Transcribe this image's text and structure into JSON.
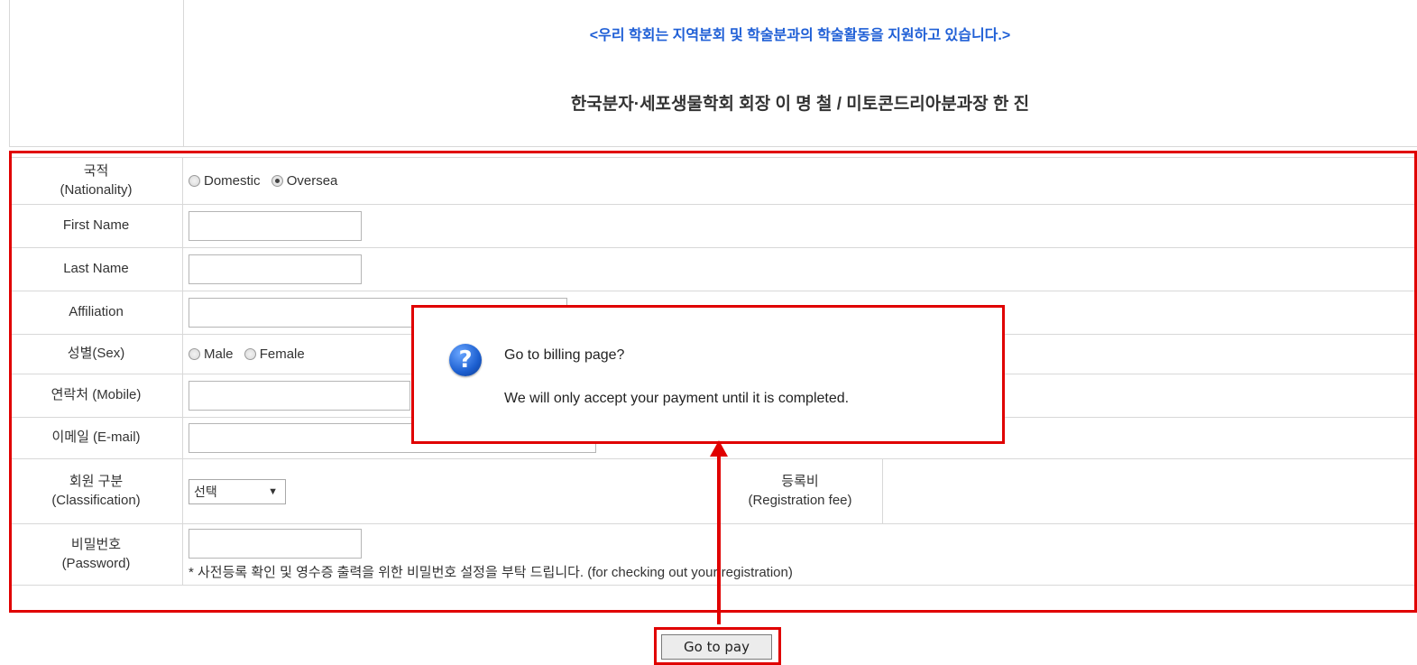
{
  "header": {
    "notice": "<우리 학회는 지역분회 및 학술분과의 학술활동을 지원하고 있습니다.>",
    "title": "한국분자·세포생물학회 회장 이 명 철 / 미토콘드리아분과장 한 진"
  },
  "form": {
    "nationality": {
      "label_ko": "국적",
      "label_en": "(Nationality)",
      "options": [
        "Domestic",
        "Oversea"
      ],
      "selected": "Oversea"
    },
    "first_name": {
      "label": "First Name",
      "value": ""
    },
    "last_name": {
      "label": "Last Name",
      "value": ""
    },
    "affiliation": {
      "label": "Affiliation",
      "value": ""
    },
    "sex": {
      "label": "성별(Sex)",
      "options": [
        "Male",
        "Female"
      ],
      "selected": ""
    },
    "mobile": {
      "label": "연락처 (Mobile)",
      "value": ""
    },
    "email": {
      "label": "이메일 (E-mail)",
      "value": ""
    },
    "classification": {
      "label_ko": "회원 구분",
      "label_en": "(Classification)",
      "selected": "선택"
    },
    "registration_fee": {
      "label_ko": "등록비",
      "label_en": "(Registration fee)",
      "value": ""
    },
    "password": {
      "label_ko": "비밀번호",
      "label_en": "(Password)",
      "note": "* 사전등록 확인 및 영수증 출력을 위한 비밀번호 설정을 부탁 드립니다. (for checking out your registration)"
    }
  },
  "dialog": {
    "icon": "question-icon",
    "title": "Go to billing page?",
    "message": "We will only accept your payment until it is completed."
  },
  "actions": {
    "pay_label": "Go to pay"
  },
  "colors": {
    "highlight": "#e00000",
    "notice": "#1f5fd6"
  }
}
